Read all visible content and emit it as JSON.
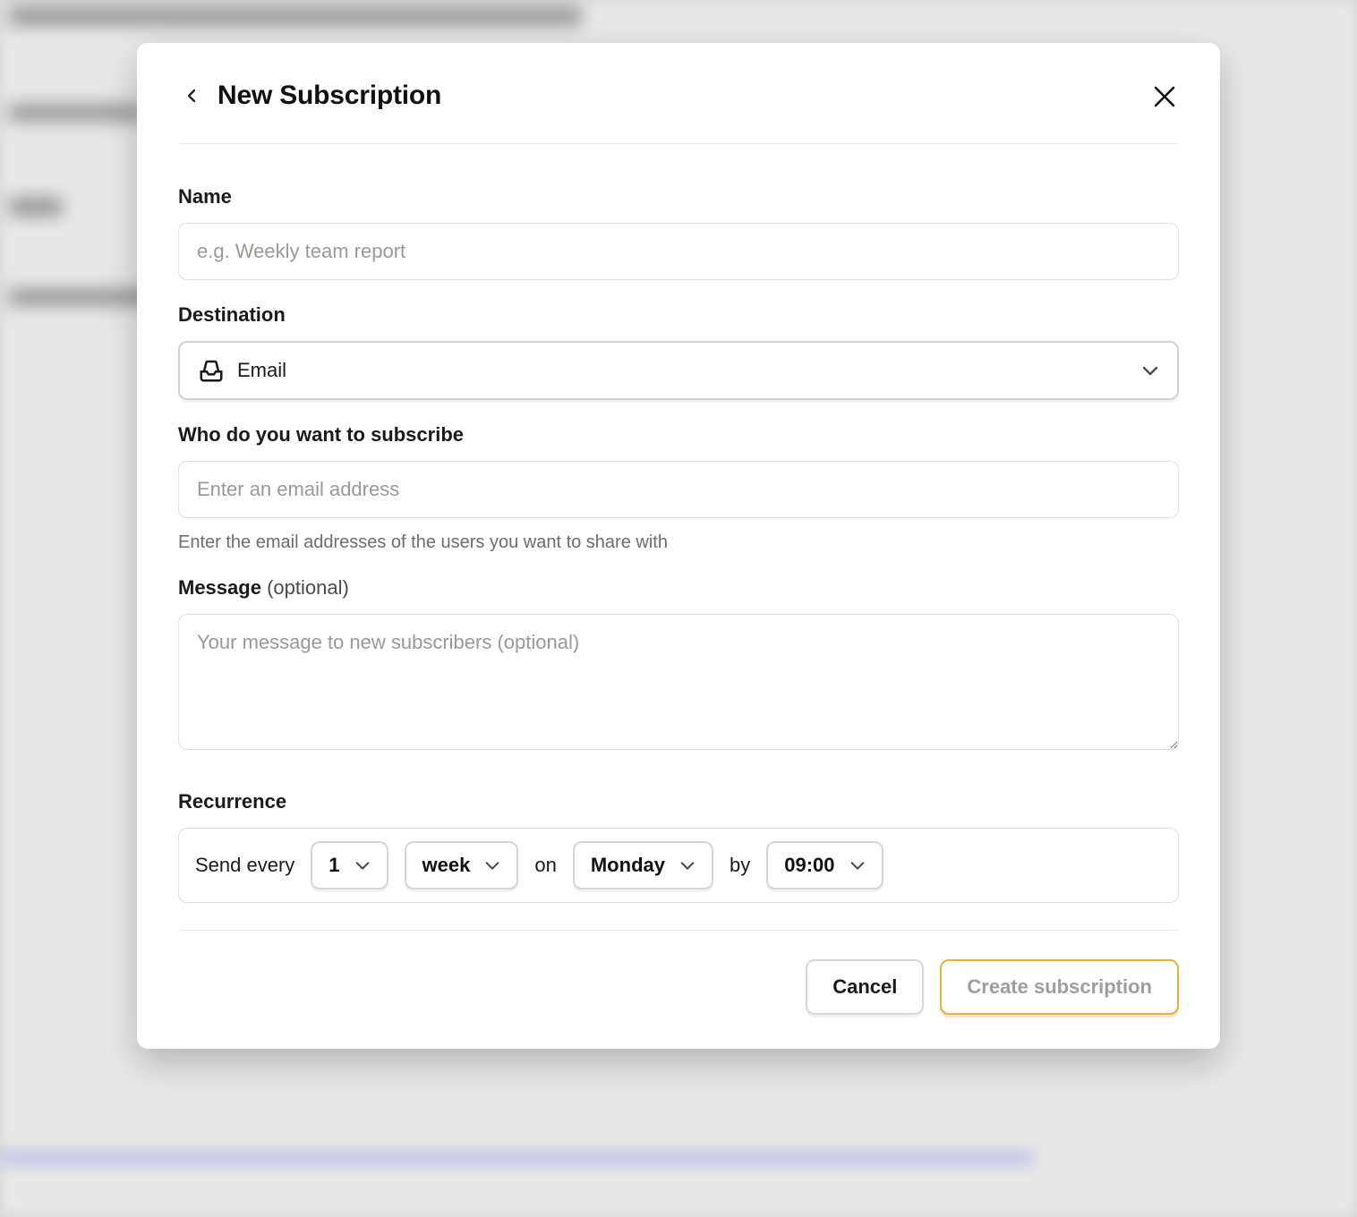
{
  "modal": {
    "title": "New Subscription",
    "name": {
      "label": "Name",
      "placeholder": "e.g. Weekly team report",
      "value": ""
    },
    "destination": {
      "label": "Destination",
      "selected": "Email",
      "icon": "inbox-icon"
    },
    "subscribe": {
      "label": "Who do you want to subscribe",
      "placeholder": "Enter an email address",
      "value": "",
      "help": "Enter the email addresses of the users you want to share with"
    },
    "message": {
      "label": "Message",
      "optional_text": "(optional)",
      "placeholder": "Your message to new subscribers (optional)",
      "value": ""
    },
    "recurrence": {
      "label": "Recurrence",
      "send_every": "Send every",
      "interval": "1",
      "unit": "week",
      "on_label": "on",
      "day": "Monday",
      "by_label": "by",
      "time": "09:00"
    },
    "footer": {
      "cancel": "Cancel",
      "create": "Create subscription"
    }
  }
}
